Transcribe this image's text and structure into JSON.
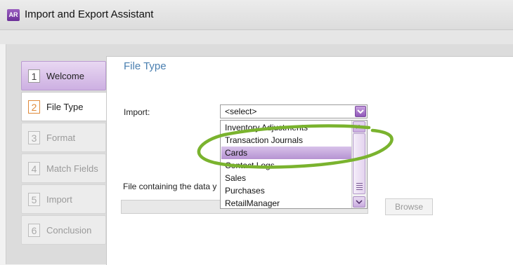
{
  "window": {
    "icon_text": "AR",
    "title": "Import and Export Assistant"
  },
  "steps": [
    {
      "num": "1",
      "label": "Welcome",
      "state": "done"
    },
    {
      "num": "2",
      "label": "File Type",
      "state": "active"
    },
    {
      "num": "3",
      "label": "Format",
      "state": "disabled"
    },
    {
      "num": "4",
      "label": "Match Fields",
      "state": "disabled"
    },
    {
      "num": "5",
      "label": "Import",
      "state": "disabled"
    },
    {
      "num": "6",
      "label": "Conclusion",
      "state": "disabled"
    }
  ],
  "page": {
    "title": "File Type",
    "import_label": "Import:",
    "import_select_value": "<select>",
    "file_label": "File containing the data y",
    "file_path_value": "",
    "browse_label": "Browse"
  },
  "dropdown": {
    "options": [
      "Inventory Adjustments",
      "Transaction Journals",
      "Cards",
      "Contact Logs",
      "Sales",
      "Purchases",
      "RetailManager"
    ],
    "highlighted": "Cards"
  },
  "colors": {
    "accent_purple": "#8f56b8",
    "title_blue": "#4a7fb0",
    "annotation_green": "#7ab32e"
  }
}
